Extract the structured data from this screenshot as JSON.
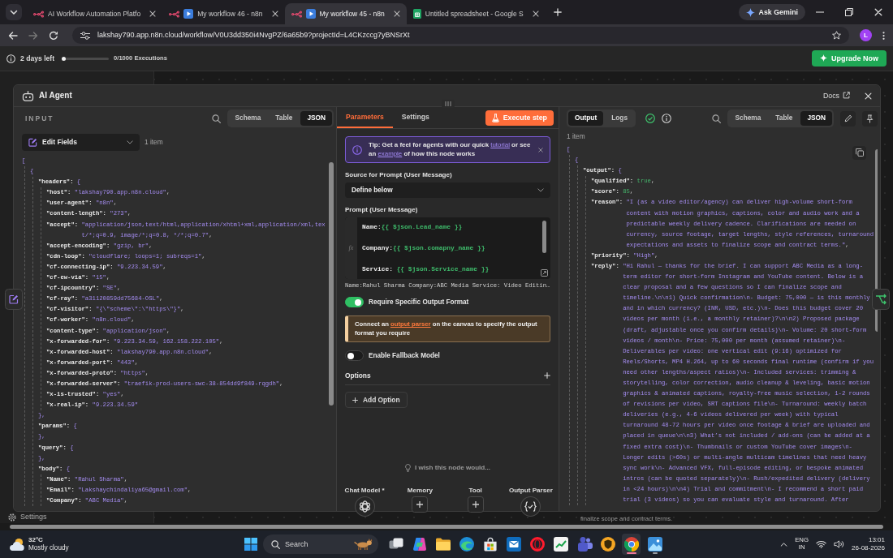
{
  "browser": {
    "tabs": [
      {
        "title": "AI Workflow Automation Platfo",
        "kind": "n8n",
        "selected": false
      },
      {
        "title": "My workflow 46 - n8n",
        "kind": "workflow",
        "selected": false
      },
      {
        "title": "My workflow 45 - n8n",
        "kind": "workflow",
        "selected": true
      },
      {
        "title": "Untitled spreadsheet - Google S",
        "kind": "sheet",
        "selected": false
      }
    ],
    "ask_gemini": "Ask Gemini",
    "url": "lakshay790.app.n8n.cloud/workflow/V0U3dd350i4NvgPZ/6a65b9?projectId=L4CKzccg7yBNSrXt",
    "profile": "L"
  },
  "trial_banner": {
    "days_left": "2 days left",
    "level": 0,
    "executions": "0/1000 Executions",
    "upgrade": "Upgrade Now"
  },
  "background": {
    "sidebar_item": "Settings",
    "canvas_text": "finalize scope and contract terms."
  },
  "modal": {
    "title": "AI Agent",
    "docs": "Docs"
  },
  "input_panel": {
    "label": "INPUT",
    "views": [
      {
        "label": "Schema",
        "selected": false
      },
      {
        "label": "Table",
        "selected": false
      },
      {
        "label": "JSON",
        "selected": true
      }
    ],
    "node": "Edit Fields",
    "count": "1 item",
    "tree": [
      {
        "kind": "array",
        "open": "[",
        "children": [
          {
            "kind": "object",
            "open": "{",
            "children": [
              {
                "kind": "object",
                "key": "\"headers\":",
                "open": "{",
                "children": [
                  {
                    "kind": "string",
                    "key": "\"host\":",
                    "value": "\"lakshay790.app.n8n.cloud\"",
                    "comma": ","
                  },
                  {
                    "kind": "string",
                    "key": "\"user-agent\":",
                    "value": "\"n8n\"",
                    "comma": ","
                  },
                  {
                    "kind": "string",
                    "key": "\"content-length\":",
                    "value": "\"273\"",
                    "comma": ","
                  },
                  {
                    "kind": "string",
                    "key": "\"accept\":",
                    "value": "\"application/json,text/html,application/xhtml+xml,application/xml,text/*;q=0.9, image/*;q=0.8, */*;q=0.7\"",
                    "comma": ","
                  },
                  {
                    "kind": "string",
                    "key": "\"accept-encoding\":",
                    "value": "\"gzip, br\"",
                    "comma": ","
                  },
                  {
                    "kind": "string",
                    "key": "\"cdn-loop\":",
                    "value": "\"cloudflare; loops=1; subreqs=1\"",
                    "comma": ","
                  },
                  {
                    "kind": "string",
                    "key": "\"cf-connecting-ip\":",
                    "value": "\"9.223.34.59\"",
                    "comma": ","
                  },
                  {
                    "kind": "string",
                    "key": "\"cf-ew-via\":",
                    "value": "\"15\"",
                    "comma": ","
                  },
                  {
                    "kind": "string",
                    "key": "\"cf-ipcountry\":",
                    "value": "\"SE\"",
                    "comma": ","
                  },
                  {
                    "kind": "string",
                    "key": "\"cf-ray\":",
                    "value": "\"a31120859dd75684-OSL\"",
                    "comma": ","
                  },
                  {
                    "kind": "string",
                    "key": "\"cf-visitor\":",
                    "value": "\"{\\\"scheme\\\":\\\"https\\\"}\"",
                    "comma": ","
                  },
                  {
                    "kind": "string",
                    "key": "\"cf-worker\":",
                    "value": "\"n8n.cloud\"",
                    "comma": ","
                  },
                  {
                    "kind": "string",
                    "key": "\"content-type\":",
                    "value": "\"application/json\"",
                    "comma": ","
                  },
                  {
                    "kind": "string",
                    "key": "\"x-forwarded-for\":",
                    "value": "\"9.223.34.59, 162.158.222.105\"",
                    "comma": ","
                  },
                  {
                    "kind": "string",
                    "key": "\"x-forwarded-host\":",
                    "value": "\"lakshay790.app.n8n.cloud\"",
                    "comma": ","
                  },
                  {
                    "kind": "string",
                    "key": "\"x-forwarded-port\":",
                    "value": "\"443\"",
                    "comma": ","
                  },
                  {
                    "kind": "string",
                    "key": "\"x-forwarded-proto\":",
                    "value": "\"https\"",
                    "comma": ","
                  },
                  {
                    "kind": "string",
                    "key": "\"x-forwarded-server\":",
                    "value": "\"traefik-prod-users-swc-38-854dd9f849-rqgdh\"",
                    "comma": ","
                  },
                  {
                    "kind": "string",
                    "key": "\"x-is-trusted\":",
                    "value": "\"yes\"",
                    "comma": ","
                  },
                  {
                    "kind": "string",
                    "key": "\"x-real-ip\":",
                    "value": "\"9.223.34.59\""
                  }
                ],
                "close": "},"
              },
              {
                "kind": "object",
                "key": "\"params\":",
                "open": "{",
                "close": "},"
              },
              {
                "kind": "object",
                "key": "\"query\":",
                "open": "{",
                "close": "},"
              },
              {
                "kind": "object",
                "key": "\"body\":",
                "open": "{",
                "children": [
                  {
                    "kind": "string",
                    "key": "\"Name\":",
                    "value": "\"Rahul Sharma\"",
                    "comma": ","
                  },
                  {
                    "kind": "string",
                    "key": "\"Email\":",
                    "value": "\"Lakshaychindaliya65@gmail.com\"",
                    "comma": ","
                  },
                  {
                    "kind": "string",
                    "key": "\"Company\":",
                    "value": "\"ABC Media\"",
                    "comma": ","
                  }
                ]
              }
            ]
          }
        ]
      }
    ]
  },
  "parameters_panel": {
    "tabs": [
      {
        "label": "Parameters",
        "selected": true
      },
      {
        "label": "Settings",
        "selected": false
      }
    ],
    "execute": "Execute step",
    "tip": [
      {
        "text": "Tip: Get a feel for agents with our quick ",
        "kind": "text"
      },
      {
        "text": "tutorial",
        "kind": "link"
      },
      {
        "text": " or see an ",
        "kind": "text"
      },
      {
        "text": "example",
        "kind": "link"
      },
      {
        "text": " of how this node works",
        "kind": "text"
      }
    ],
    "source": {
      "label": "Source for Prompt (User Message)",
      "value": "Define below"
    },
    "prompt": {
      "label": "Prompt (User Message)",
      "gutter": "fx",
      "lines": [
        {
          "text": "Name:",
          "expression": "{{ $json.Lead_name }}"
        },
        {
          "text": "Company:",
          "expression": "{{ $json.comapny_name }}"
        },
        {
          "text": "Service: ",
          "expression": "{{ $json.Service_name }}"
        }
      ],
      "preview": "Name:Rahul Sharma Company:ABC Media Service: Video Editin…"
    },
    "output_format": {
      "label": "Require Specific Output Format",
      "on": true
    },
    "notice": [
      {
        "text": "Connect an ",
        "kind": "text"
      },
      {
        "text": "output parser",
        "kind": "link"
      },
      {
        "text": " on the canvas to specify the output format you require",
        "kind": "text"
      }
    ],
    "fallback": {
      "label": "Enable Fallback Model",
      "on": false
    },
    "options": "Options",
    "add_option": "Add Option",
    "feedback": "I wish this node would...",
    "connectors": [
      {
        "label": "Chat Model *",
        "kind": "model"
      },
      {
        "label": "Memory",
        "kind": "add"
      },
      {
        "label": "Tool",
        "kind": "add"
      },
      {
        "label": "Output Parser",
        "kind": "parser"
      }
    ]
  },
  "output_panel": {
    "modes": [
      {
        "label": "Output",
        "selected": true
      },
      {
        "label": "Logs",
        "selected": false
      }
    ],
    "views": [
      {
        "label": "Schema",
        "selected": false
      },
      {
        "label": "Table",
        "selected": false
      },
      {
        "label": "JSON",
        "selected": true
      }
    ],
    "count": "1 item",
    "tree": [
      {
        "kind": "array",
        "open": "[",
        "children": [
          {
            "kind": "object",
            "open": "{",
            "children": [
              {
                "kind": "object",
                "key": "\"output\":",
                "open": "{",
                "children": [
                  {
                    "kind": "boolean",
                    "key": "\"qualified\":",
                    "value": "true",
                    "comma": ","
                  },
                  {
                    "kind": "number",
                    "key": "\"score\":",
                    "value": "85",
                    "comma": ","
                  },
                  {
                    "kind": "string",
                    "key": "\"reason\":",
                    "value": "\"I (as a video editor/agency) can deliver high-volume short-form content with motion graphics, captions, color and audio work and a predictable weekly delivery cadence. Clarifications are needed on currency, source footage, target lengths, style references, turnaround expectations and assets to finalize scope and contract terms.\"",
                    "comma": ","
                  },
                  {
                    "kind": "string",
                    "key": "\"priority\":",
                    "value": "\"High\"",
                    "comma": ","
                  },
                  {
                    "kind": "string",
                    "key": "\"reply\":",
                    "value": "\"Hi Rahul — thanks for the brief. I can support ABC Media as a long-term editor for short-form Instagram and YouTube content. Below is a clear proposal and a few questions so I can finalize scope and timeline.\\n\\n1) Quick confirmation\\n- Budget: 75,000 — is this monthly and in which currency? (INR, USD, etc.)\\n- Does this budget cover 20 videos per month (i.e., a monthly retainer)?\\n\\n2) Proposed package (draft, adjustable once you confirm details)\\n- Volume: 20 short-form videos / month\\n- Price: 75,000 per month (assumed retainer)\\n- Deliverables per video: one vertical edit (9:16) optimized for Reels/Shorts, MP4 H.264, up to 60 seconds final runtime (confirm if you need other lengths/aspect ratios)\\n- Included services: trimming & storytelling, color correction, audio cleanup & leveling, basic motion graphics & animated captions, royalty-free music selection, 1-2 rounds of revisions per video, SRT captions file\\n- Turnaround: weekly batch deliveries (e.g., 4-6 videos delivered per week) with typical turnaround 48-72 hours per video once footage & brief are uploaded and placed in queue\\n\\n3) What’s not included / add-ons (can be added at a fixed extra cost)\\n- Thumbnails or custom YouTube cover images\\n- Longer edits (>60s) or multi-angle multicam timelines that need heavy sync work\\n- Advanced VFX, full-episode editing, or bespoke animated intros (can be quoted separately)\\n- Rush/expedited delivery (delivery in <24 hours)\\n\\n4) Trial and commitment\\n- I recommend a short paid trial (3 videos) so you can evaluate style and turnaround. After"
                  }
                ]
              }
            ]
          }
        ]
      }
    ]
  },
  "taskbar": {
    "temperature": "32°C",
    "weather": "Mostly cloudy",
    "search": {
      "placeholder": "Search"
    },
    "apps": [
      {
        "kind": "taskview",
        "open": false,
        "selected": false
      },
      {
        "kind": "copilot",
        "open": false,
        "selected": false
      },
      {
        "kind": "explorer",
        "open": false,
        "selected": false
      },
      {
        "kind": "edge",
        "open": false,
        "selected": false
      },
      {
        "kind": "store",
        "open": false,
        "selected": false
      },
      {
        "kind": "mail",
        "open": false,
        "selected": false
      },
      {
        "kind": "opera",
        "open": false,
        "selected": false
      },
      {
        "kind": "chart",
        "open": false,
        "selected": false
      },
      {
        "kind": "teams",
        "open": false,
        "selected": false
      },
      {
        "kind": "shield",
        "open": false,
        "selected": false
      },
      {
        "kind": "chrome",
        "open": true,
        "selected": true
      },
      {
        "kind": "photos",
        "open": true,
        "selected": false
      }
    ],
    "language": "ENG",
    "region": "IN",
    "time": "13:01",
    "date": "26-08-2026"
  }
}
